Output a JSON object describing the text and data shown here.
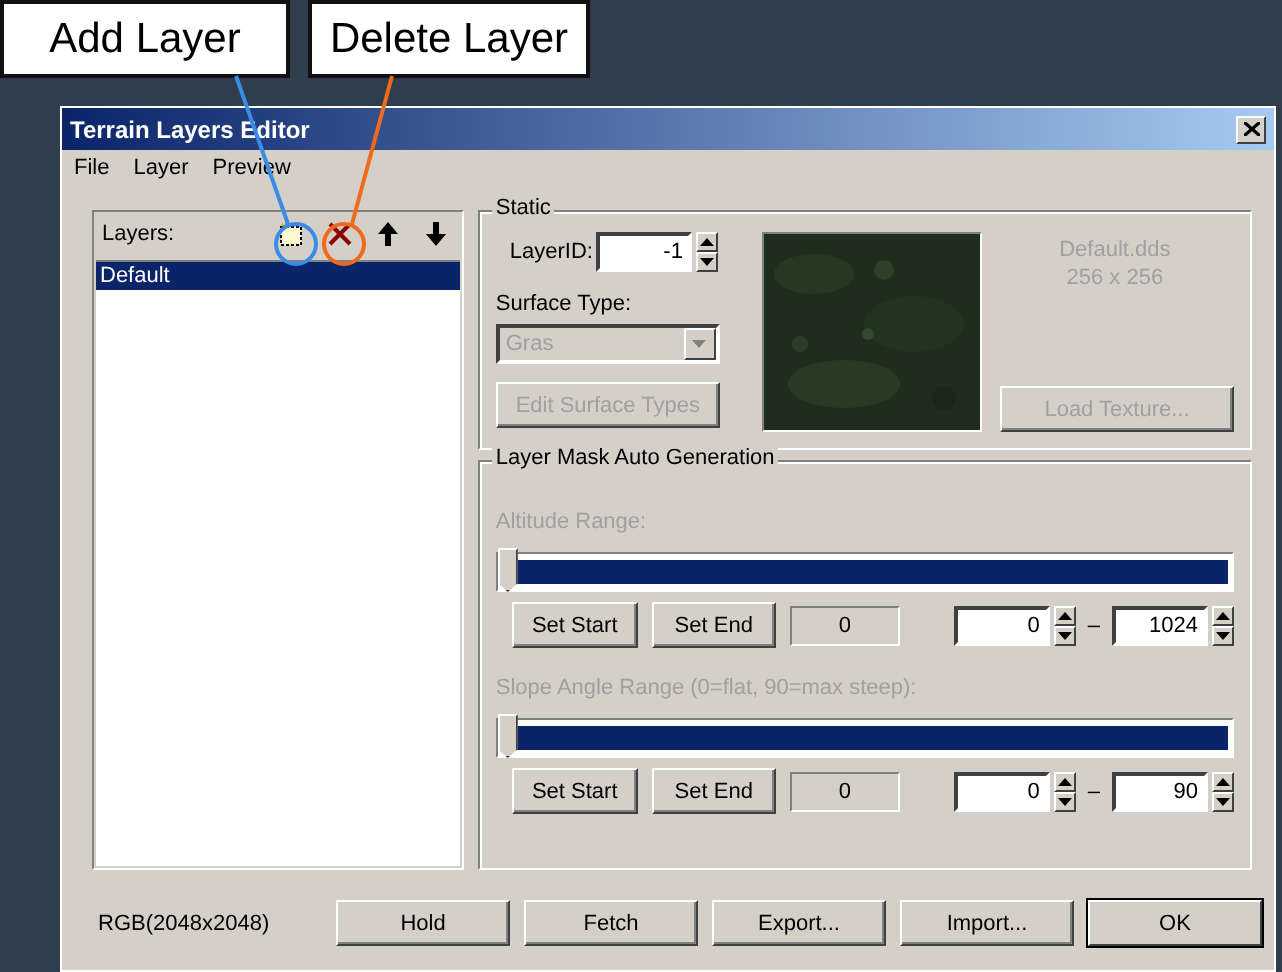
{
  "callouts": [
    {
      "label": "Add Layer",
      "color": "#3c8ce6"
    },
    {
      "label": "Delete Layer",
      "color": "#f06a1e"
    }
  ],
  "window": {
    "title": "Terrain Layers Editor"
  },
  "menu": [
    "File",
    "Layer",
    "Preview"
  ],
  "layers_panel": {
    "label": "Layers:",
    "layers": [
      {
        "name": "Default",
        "selected": true
      }
    ]
  },
  "static": {
    "title": "Static",
    "layer_id_label": "LayerID:",
    "layer_id": "-1",
    "surface_type_label": "Surface Type:",
    "surface_type": {
      "value": "Gras",
      "disabled": true
    },
    "edit_button": {
      "label": "Edit Surface Types",
      "disabled": true
    },
    "texture_name": "Default.dds",
    "texture_size": "256 x 256",
    "load_button": {
      "label": "Load Texture...",
      "disabled": true
    }
  },
  "mask": {
    "title": "Layer Mask Auto Generation",
    "ranges": [
      {
        "label": "Altitude Range:",
        "disabled": true,
        "level": 0,
        "set_start": "Set Start",
        "set_end": "Set End",
        "readout": "0",
        "min": "0",
        "separator": "–",
        "max": "1024"
      },
      {
        "label": "Slope Angle Range (0=flat, 90=max steep):",
        "disabled": true,
        "level": 0,
        "set_start": "Set Start",
        "set_end": "Set End",
        "readout": "0",
        "min": "0",
        "separator": "–",
        "max": "90"
      }
    ]
  },
  "status": "RGB(2048x2048)",
  "buttons": [
    {
      "label": "Hold",
      "default": false
    },
    {
      "label": "Fetch",
      "default": false
    },
    {
      "label": "Export...",
      "default": false
    },
    {
      "label": "Import...",
      "default": false
    },
    {
      "label": "OK",
      "default": true
    }
  ]
}
